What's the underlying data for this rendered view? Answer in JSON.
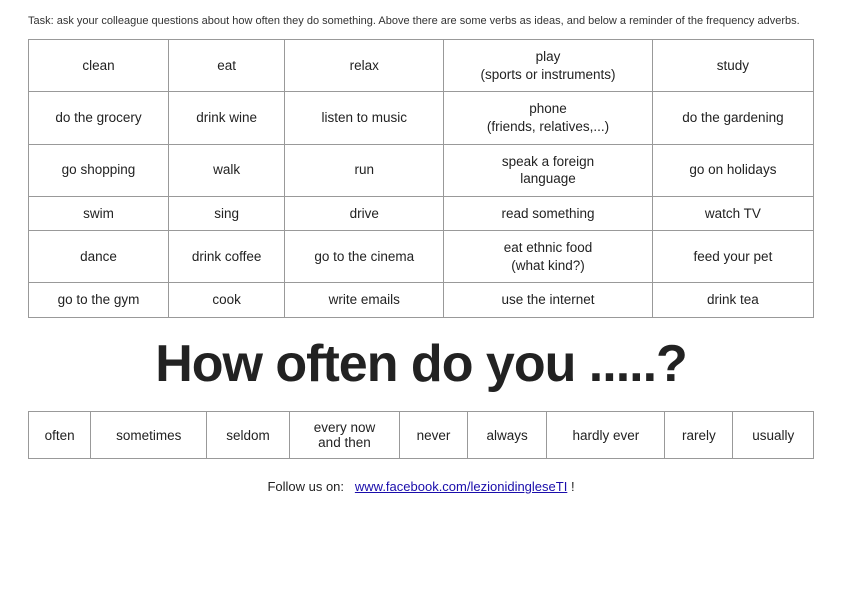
{
  "task": {
    "text": "Task: ask your colleague questions about how often they do something. Above there are some verbs as ideas, and below a reminder of the frequency adverbs."
  },
  "verbs_table": {
    "rows": [
      [
        "clean",
        "eat",
        "relax",
        "play\n(sports or instruments)",
        "study"
      ],
      [
        "do the grocery",
        "drink wine",
        "listen to music",
        "phone\n(friends, relatives,...)",
        "do the gardening"
      ],
      [
        "go shopping",
        "walk",
        "run",
        "speak a foreign\nlanguage",
        "go on holidays"
      ],
      [
        "swim",
        "sing",
        "drive",
        "read something",
        "watch TV"
      ],
      [
        "dance",
        "drink coffee",
        "go to the cinema",
        "eat ethnic food\n(what kind?)",
        "feed your pet"
      ],
      [
        "go to the gym",
        "cook",
        "write emails",
        "use the internet",
        "drink tea"
      ]
    ]
  },
  "big_question": "How often do you .....?",
  "adverbs": {
    "items": [
      "often",
      "sometimes",
      "seldom",
      "every now\nand then",
      "never",
      "always",
      "hardly ever",
      "rarely",
      "usually"
    ]
  },
  "follow_us": {
    "prefix": "Follow us on:",
    "link_text": "www.facebook.com/lezionidingleseTI",
    "link_href": "https://www.facebook.com/lezionidingleseTI",
    "suffix": " !"
  }
}
